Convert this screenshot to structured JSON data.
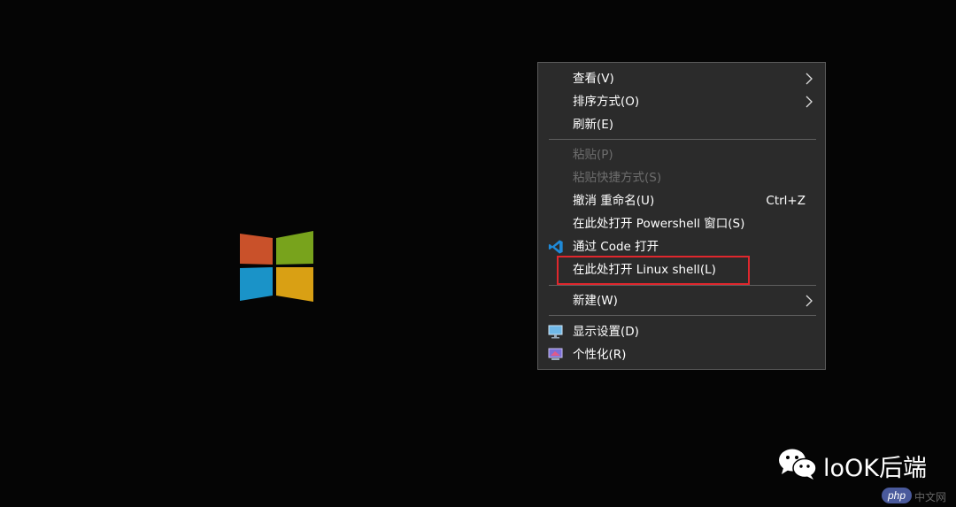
{
  "context_menu": {
    "items": [
      {
        "label": "查看(V)",
        "submenu": true,
        "enabled": true
      },
      {
        "label": "排序方式(O)",
        "submenu": true,
        "enabled": true
      },
      {
        "label": "刷新(E)",
        "enabled": true
      },
      {
        "label": "粘贴(P)",
        "enabled": false
      },
      {
        "label": "粘贴快捷方式(S)",
        "enabled": false
      },
      {
        "label": "撤消 重命名(U)",
        "shortcut": "Ctrl+Z",
        "enabled": true
      },
      {
        "label": "在此处打开 Powershell 窗口(S)",
        "enabled": true
      },
      {
        "label": "通过 Code 打开",
        "icon": "vscode-icon",
        "enabled": true
      },
      {
        "label": "在此处打开 Linux shell(L)",
        "enabled": true,
        "highlighted": true
      },
      {
        "label": "新建(W)",
        "submenu": true,
        "enabled": true
      },
      {
        "label": "显示设置(D)",
        "icon": "display-settings-icon",
        "enabled": true
      },
      {
        "label": "个性化(R)",
        "icon": "personalize-icon",
        "enabled": true
      }
    ]
  },
  "watermark": {
    "text": "loOK后端",
    "badge": "php",
    "site": "中文网"
  },
  "colors": {
    "menu_bg": "#2b2b2b",
    "highlight_border": "#e0272d",
    "logo_red": "#d45a2a",
    "logo_green": "#7aa01e",
    "logo_blue": "#1a9bd0",
    "logo_yellow": "#e0a11a"
  }
}
